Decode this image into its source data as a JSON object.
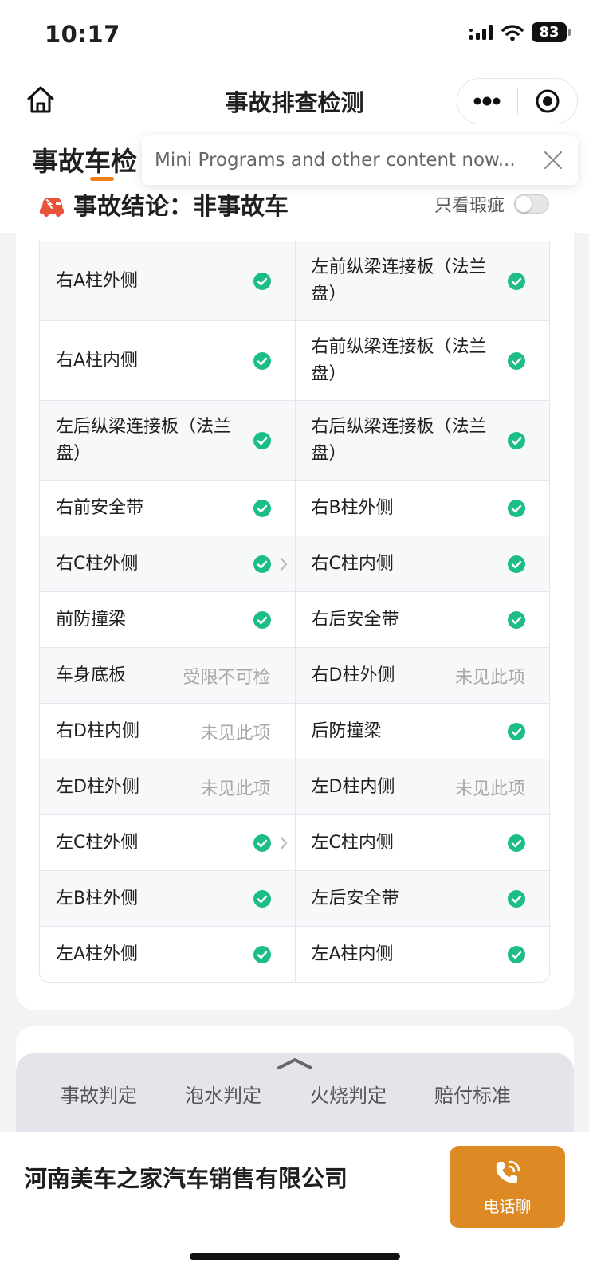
{
  "status_bar": {
    "time": "10:17",
    "battery": "83"
  },
  "nav": {
    "title": "事故排查检测"
  },
  "page": {
    "heading": "事故车检",
    "verdict": "事故结论：非事故车",
    "filter_label": "只看瑕疵"
  },
  "toast": {
    "text": "Mini Programs and other content now..."
  },
  "table": {
    "rows": [
      [
        {
          "label": "右A柱外侧",
          "status": "ok"
        },
        {
          "label": "左前纵梁连接板（法兰盘）",
          "status": "ok"
        }
      ],
      [
        {
          "label": "右A柱内侧",
          "status": "ok"
        },
        {
          "label": "右前纵梁连接板（法兰盘）",
          "status": "ok"
        }
      ],
      [
        {
          "label": "左后纵梁连接板（法兰盘）",
          "status": "ok"
        },
        {
          "label": "右后纵梁连接板（法兰盘）",
          "status": "ok"
        }
      ],
      [
        {
          "label": "右前安全带",
          "status": "ok"
        },
        {
          "label": "右B柱外侧",
          "status": "ok"
        }
      ],
      [
        {
          "label": "右C柱外侧",
          "status": "ok",
          "has_detail": true
        },
        {
          "label": "右C柱内侧",
          "status": "ok"
        }
      ],
      [
        {
          "label": "前防撞梁",
          "status": "ok"
        },
        {
          "label": "右后安全带",
          "status": "ok"
        }
      ],
      [
        {
          "label": "车身底板",
          "status": "text",
          "status_text": "受限不可检"
        },
        {
          "label": "右D柱外侧",
          "status": "text",
          "status_text": "未见此项"
        }
      ],
      [
        {
          "label": "右D柱内侧",
          "status": "text",
          "status_text": "未见此项"
        },
        {
          "label": "后防撞梁",
          "status": "ok"
        }
      ],
      [
        {
          "label": "左D柱外侧",
          "status": "text",
          "status_text": "未见此项"
        },
        {
          "label": "左D柱内侧",
          "status": "text",
          "status_text": "未见此项"
        }
      ],
      [
        {
          "label": "左C柱外侧",
          "status": "ok",
          "has_detail": true
        },
        {
          "label": "左C柱内侧",
          "status": "ok"
        }
      ],
      [
        {
          "label": "左B柱外侧",
          "status": "ok"
        },
        {
          "label": "左后安全带",
          "status": "ok"
        }
      ],
      [
        {
          "label": "左A柱外侧",
          "status": "ok"
        },
        {
          "label": "左A柱内侧",
          "status": "ok"
        }
      ]
    ]
  },
  "bottom_tabs": [
    "事故判定",
    "泡水判定",
    "火烧判定",
    "赔付标准"
  ],
  "footer": {
    "company": "河南美车之家汽车销售有限公司",
    "call_label": "电话聊"
  },
  "colors": {
    "accent": "#f07f1a",
    "ok_green": "#1dbd8a",
    "call_button": "#dd8a24"
  },
  "icons": [
    "home-icon",
    "more-dots-icon",
    "record-target-icon",
    "close-icon",
    "car-badge-icon",
    "check-circle-icon",
    "chevron-right-icon",
    "chevron-up-icon",
    "phone-icon"
  ]
}
